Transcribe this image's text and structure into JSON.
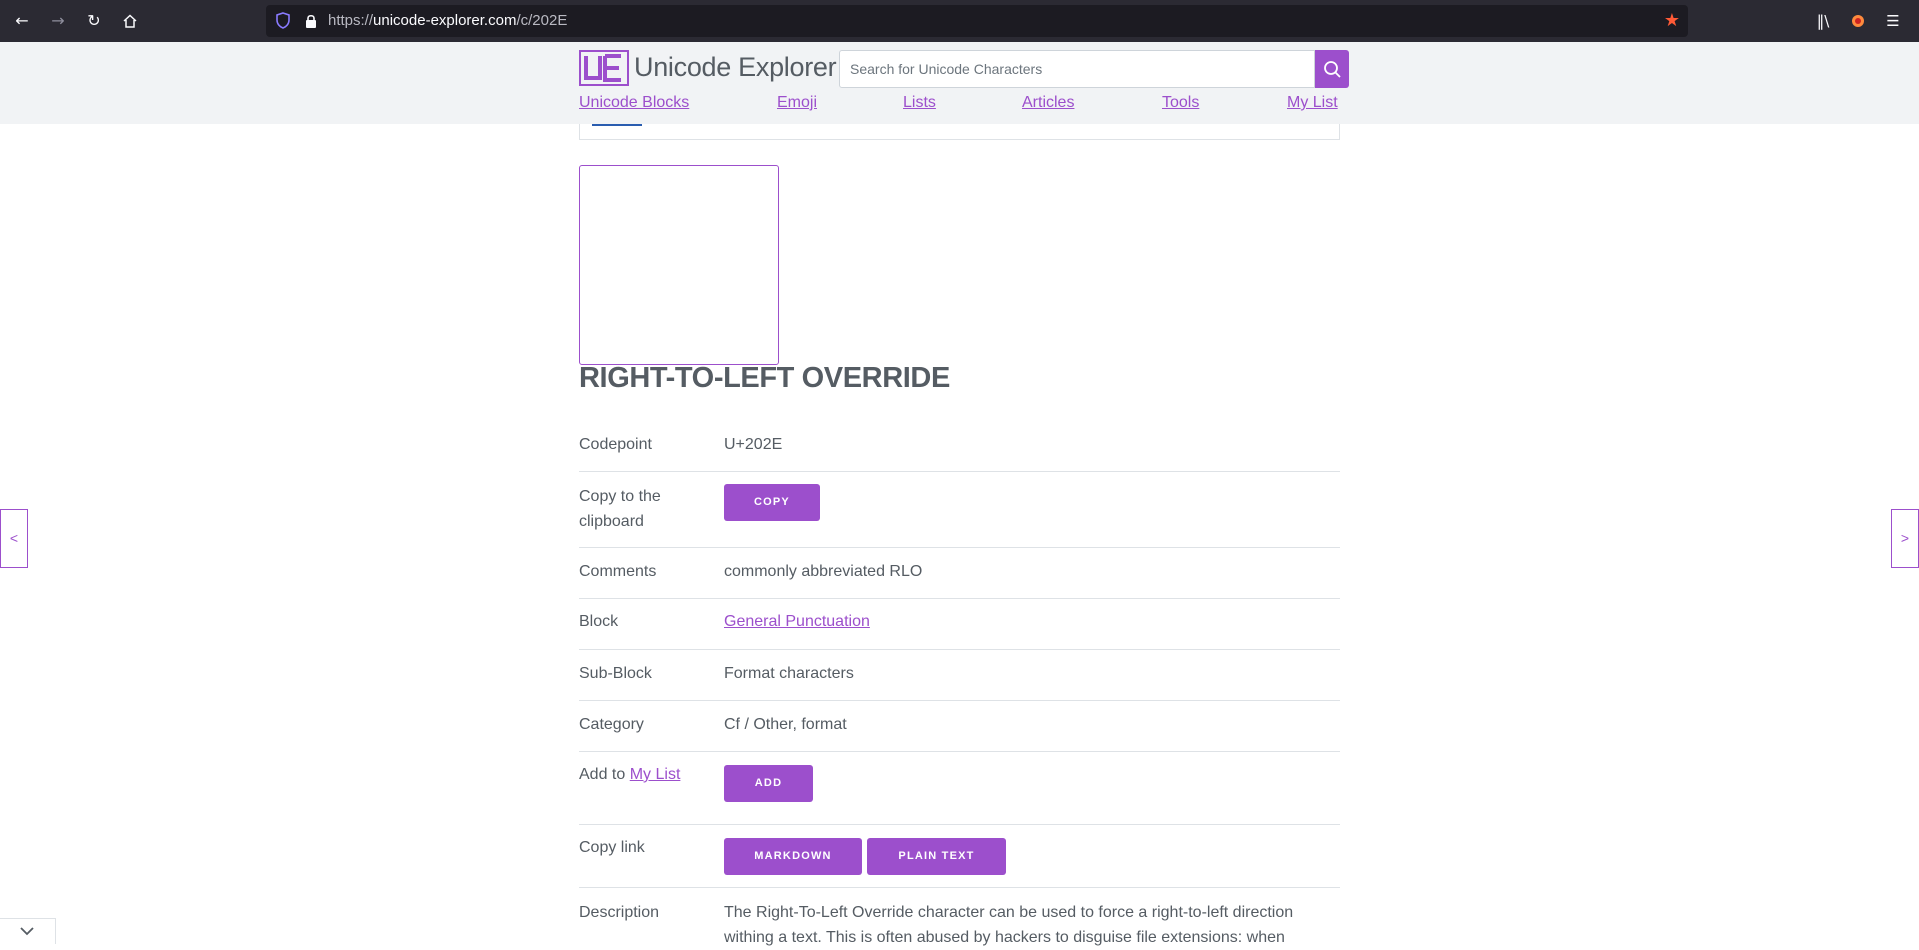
{
  "browser": {
    "url_prefix": "https://",
    "url_host": "unicode-explorer.com",
    "url_path": "/c/202E"
  },
  "site": {
    "logo_text": "Unicode Explorer",
    "search_placeholder": "Search for Unicode Characters",
    "nav": [
      "Unicode Blocks",
      "Emoji",
      "Lists",
      "Articles",
      "Tools",
      "My List"
    ]
  },
  "character": {
    "name": "RIGHT-TO-LEFT OVERRIDE",
    "prev_label": "<",
    "next_label": ">"
  },
  "properties": {
    "codepoint_label": "Codepoint",
    "codepoint_value": "U+202E",
    "copy_label": "Copy to the clipboard",
    "copy_button": "COPY",
    "comments_label": "Comments",
    "comments_value": "commonly abbreviated RLO",
    "block_label": "Block",
    "block_value": "General Punctuation",
    "subblock_label": "Sub-Block",
    "subblock_value": "Format characters",
    "category_label": "Category",
    "category_value": "Cf / Other, format",
    "addto_label": "Add to",
    "addto_link": "My List",
    "add_button": "ADD",
    "copylink_label": "Copy link",
    "markdown_button": "MARKDOWN",
    "plaintext_button": "PLAIN TEXT",
    "description_label": "Description",
    "description_value": "The Right-To-Left Override character can be used to force a right-to-left direction withing a text. This is often abused by hackers to disguise file extensions: when"
  },
  "colors": {
    "accent": "#9c4fcc",
    "text": "#555c63",
    "header_bg": "#f1f3f5",
    "chrome_bg": "#2b2a33"
  }
}
